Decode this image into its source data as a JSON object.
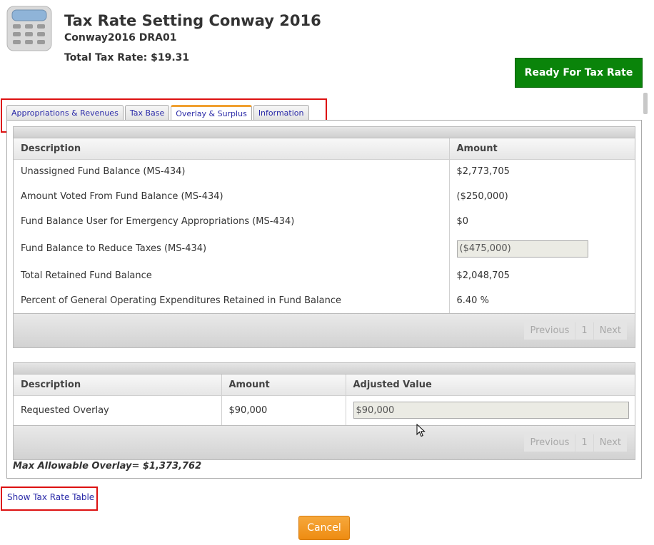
{
  "header": {
    "app_icon": "calculator-icon",
    "title": "Tax Rate Setting Conway 2016",
    "subtitle": "Conway2016 DRA01",
    "total_tax_rate": "Total Tax Rate: $19.31",
    "ready_button": "Ready For Tax Rate",
    "ready_button_color": "#0a840a"
  },
  "tabs": [
    {
      "label": "Appropriations & Revenues",
      "active": false
    },
    {
      "label": "Tax Base",
      "active": false
    },
    {
      "label": "Overlay & Surplus",
      "active": true
    },
    {
      "label": "Information",
      "active": false
    }
  ],
  "fund_grid": {
    "columns": [
      "Description",
      "Amount"
    ],
    "rows": [
      {
        "description": "Unassigned Fund Balance (MS-434)",
        "amount": "$2,773,705"
      },
      {
        "description": "Amount Voted From Fund Balance (MS-434)",
        "amount": "($250,000)"
      },
      {
        "description": "Fund Balance User for Emergency Appropriations (MS-434)",
        "amount": "$0"
      },
      {
        "description": "Fund Balance to Reduce Taxes (MS-434)",
        "amount": "($475,000)",
        "editable": true
      },
      {
        "description": "Total Retained Fund Balance",
        "amount": "$2,048,705"
      },
      {
        "description": "Percent of General Operating Expenditures Retained in Fund Balance",
        "amount": "6.40 %"
      }
    ],
    "pager": {
      "previous": "Previous",
      "page": "1",
      "next": "Next"
    }
  },
  "overlay_grid": {
    "columns": [
      "Description",
      "Amount",
      "Adjusted Value"
    ],
    "rows": [
      {
        "description": "Requested Overlay",
        "amount": "$90,000",
        "adjusted_value": "$90,000"
      }
    ],
    "pager": {
      "previous": "Previous",
      "page": "1",
      "next": "Next"
    }
  },
  "max_allowable_overlay": "Max Allowable Overlay= $1,373,762",
  "show_tax_rate_table": "Show Tax Rate Table",
  "cancel_button": "Cancel",
  "colors": {
    "accent_orange": "#ee8c12",
    "link_blue": "#2a2aa8",
    "highlight_red": "#dd1111"
  }
}
